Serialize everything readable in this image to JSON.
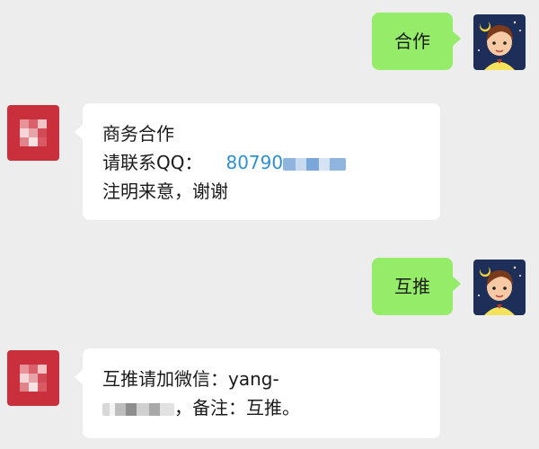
{
  "messages": [
    {
      "side": "out",
      "text": "合作"
    },
    {
      "side": "in",
      "line1": "商务合作",
      "line2_label": "请联系QQ：",
      "qq_visible": "80790",
      "line3": "注明来意，谢谢"
    },
    {
      "side": "out",
      "text": "互推"
    },
    {
      "side": "in",
      "line1": "互推请加微信：yang-",
      "line2_suffix": "，备注：互推。"
    }
  ],
  "colors": {
    "chat_bg": "#ededed",
    "bubble_out": "#95ec69",
    "bubble_in": "#ffffff",
    "link_blue": "#2f8fd1"
  },
  "icons": {
    "user_avatar": "cartoon-boy-night-avatar-icon",
    "contact_avatar": "pixelated-red-avatar-icon"
  }
}
